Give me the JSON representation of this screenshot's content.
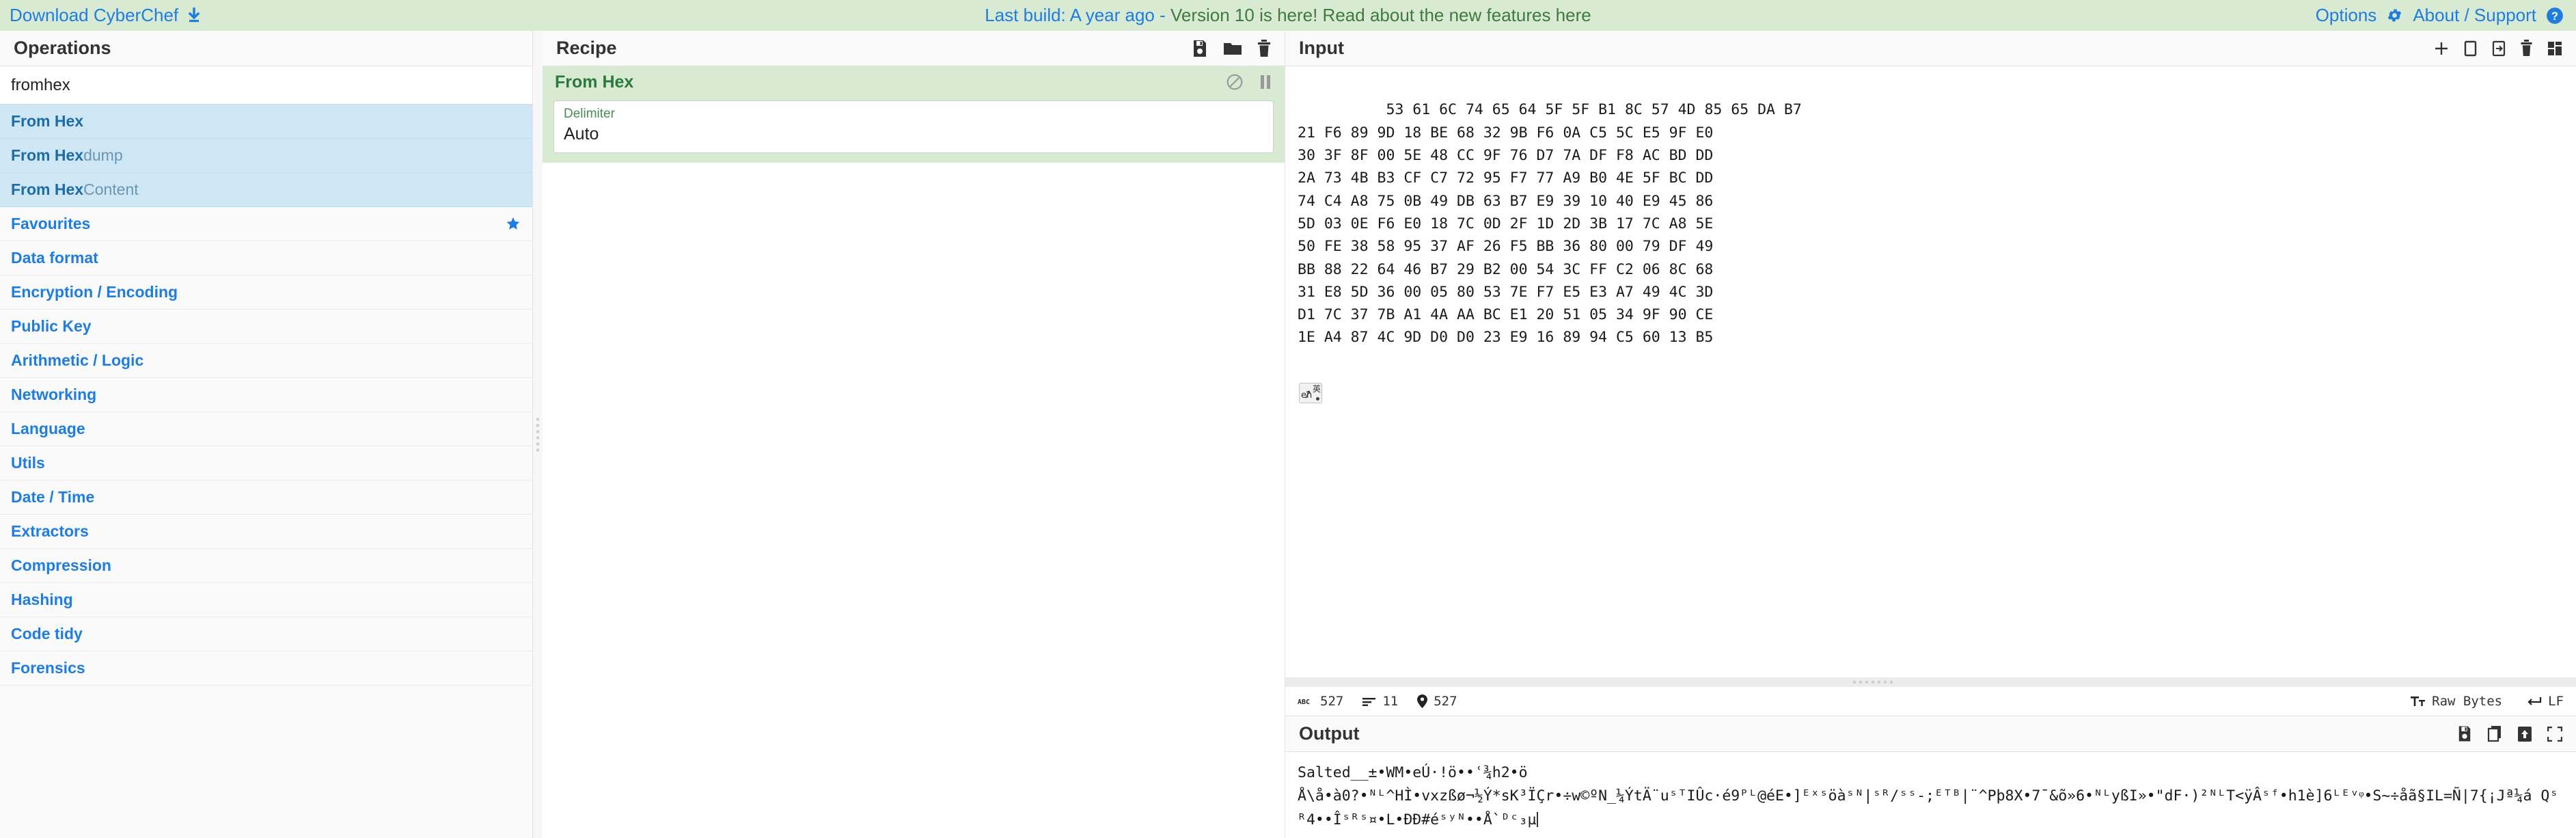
{
  "banner": {
    "download_label": "Download CyberChef",
    "download_icon": "download-icon",
    "build_prefix": "Last build: A year ago - ",
    "build_message": "Version 10 is here! Read about the new features here",
    "options_label": "Options",
    "options_icon": "gear-icon",
    "about_label": "About / Support",
    "about_icon": "question-circle-icon"
  },
  "operations": {
    "title": "Operations",
    "search_value": "fromhex",
    "search_placeholder": "Search operations...",
    "results": [
      {
        "bold": "From Hex",
        "dim": ""
      },
      {
        "bold": "From Hex",
        "dim": "dump"
      },
      {
        "bold": "From Hex",
        "dim": " Content"
      }
    ],
    "categories": [
      {
        "label": "Favourites",
        "icon": "star-icon"
      },
      {
        "label": "Data format",
        "icon": ""
      },
      {
        "label": "Encryption / Encoding",
        "icon": ""
      },
      {
        "label": "Public Key",
        "icon": ""
      },
      {
        "label": "Arithmetic / Logic",
        "icon": ""
      },
      {
        "label": "Networking",
        "icon": ""
      },
      {
        "label": "Language",
        "icon": ""
      },
      {
        "label": "Utils",
        "icon": ""
      },
      {
        "label": "Date / Time",
        "icon": ""
      },
      {
        "label": "Extractors",
        "icon": ""
      },
      {
        "label": "Compression",
        "icon": ""
      },
      {
        "label": "Hashing",
        "icon": ""
      },
      {
        "label": "Code tidy",
        "icon": ""
      },
      {
        "label": "Forensics",
        "icon": ""
      }
    ]
  },
  "recipe": {
    "title": "Recipe",
    "icons": [
      "save-icon",
      "folder-icon",
      "trash-icon"
    ],
    "operation": {
      "name": "From Hex",
      "disable_icon": "disable-icon",
      "breakpoint_icon": "pause-icon",
      "arg_label": "Delimiter",
      "arg_value": "Auto"
    }
  },
  "input": {
    "title": "Input",
    "icons": [
      "add-tab-icon",
      "open-folder-icon",
      "open-input-icon",
      "clear-icon",
      "reset-layout-icon"
    ],
    "content": "53 61 6C 74 65 64 5F 5F B1 8C 57 4D 85 65 DA B7\n21 F6 89 9D 18 BE 68 32 9B F6 0A C5 5C E5 9F E0\n30 3F 8F 00 5E 48 CC 9F 76 D7 7A DF F8 AC BD DD\n2A 73 4B B3 CF C7 72 95 F7 77 A9 B0 4E 5F BC DD\n74 C4 A8 75 0B 49 DB 63 B7 E9 39 10 40 E9 45 86\n5D 03 0E F6 E0 18 7C 0D 2F 1D 2D 3B 17 7C A8 5E\n50 FE 38 58 95 37 AF 26 F5 BB 36 80 00 79 DF 49\nBB 88 22 64 46 B7 29 B2 00 54 3C FF C2 06 8C 68\n31 E8 5D 36 00 05 80 53 7E F7 E5 E3 A7 49 4C 3D\nD1 7C 37 7B A1 4A AA BC E1 20 51 05 34 9F 90 CE\n1E A4 87 4C 9D D0 D0 23 E9 16 89 94 C5 60 13 B5",
    "ime_badge": {
      "en": "en",
      "jp": "英"
    },
    "status": {
      "length_icon": "abc-icon",
      "length_value": "527",
      "lines_icon": "lines-icon",
      "lines_value": "11",
      "position_icon": "map-pin-icon",
      "position_value": "527",
      "encoding_icon": "font-icon",
      "encoding_value": "Raw Bytes",
      "eol_icon": "enter-icon",
      "eol_value": "LF"
    }
  },
  "output": {
    "title": "Output",
    "icons": [
      "save-icon",
      "copy-icon",
      "replace-input-icon",
      "maximise-icon"
    ],
    "line1": "Salted__±•WM•eÚ·!ö••ʿ¾h2•ö",
    "line2": "Å\\å•à0?•ᴺᴸ^HÌ•vxzßø¬½Ý*sK³ÏÇr•÷w©ºN_¼ÝtÄ¨uˢᵀIÛc·é9ᴾᴸ@éE•]ᴱˣˢöàˢᴺ|ˢᴿ/ˢˢ-;ᴱᵀᴮ|¨^Pþ8X•7¯&õ»6•ᴺᴸyßI»•\"dF·)²ᴺᴸT<ÿÂˢᶠ•h1è]6ᴸᴱᵛᵠ•S~÷åã§IL=Ñ|7{¡Jª¼á Qˢᴿ4••Îˢᴿˢ¤•L•ÐÐ#éˢʸᴺ••Å`ᴰᶜ₃µ"
  }
}
